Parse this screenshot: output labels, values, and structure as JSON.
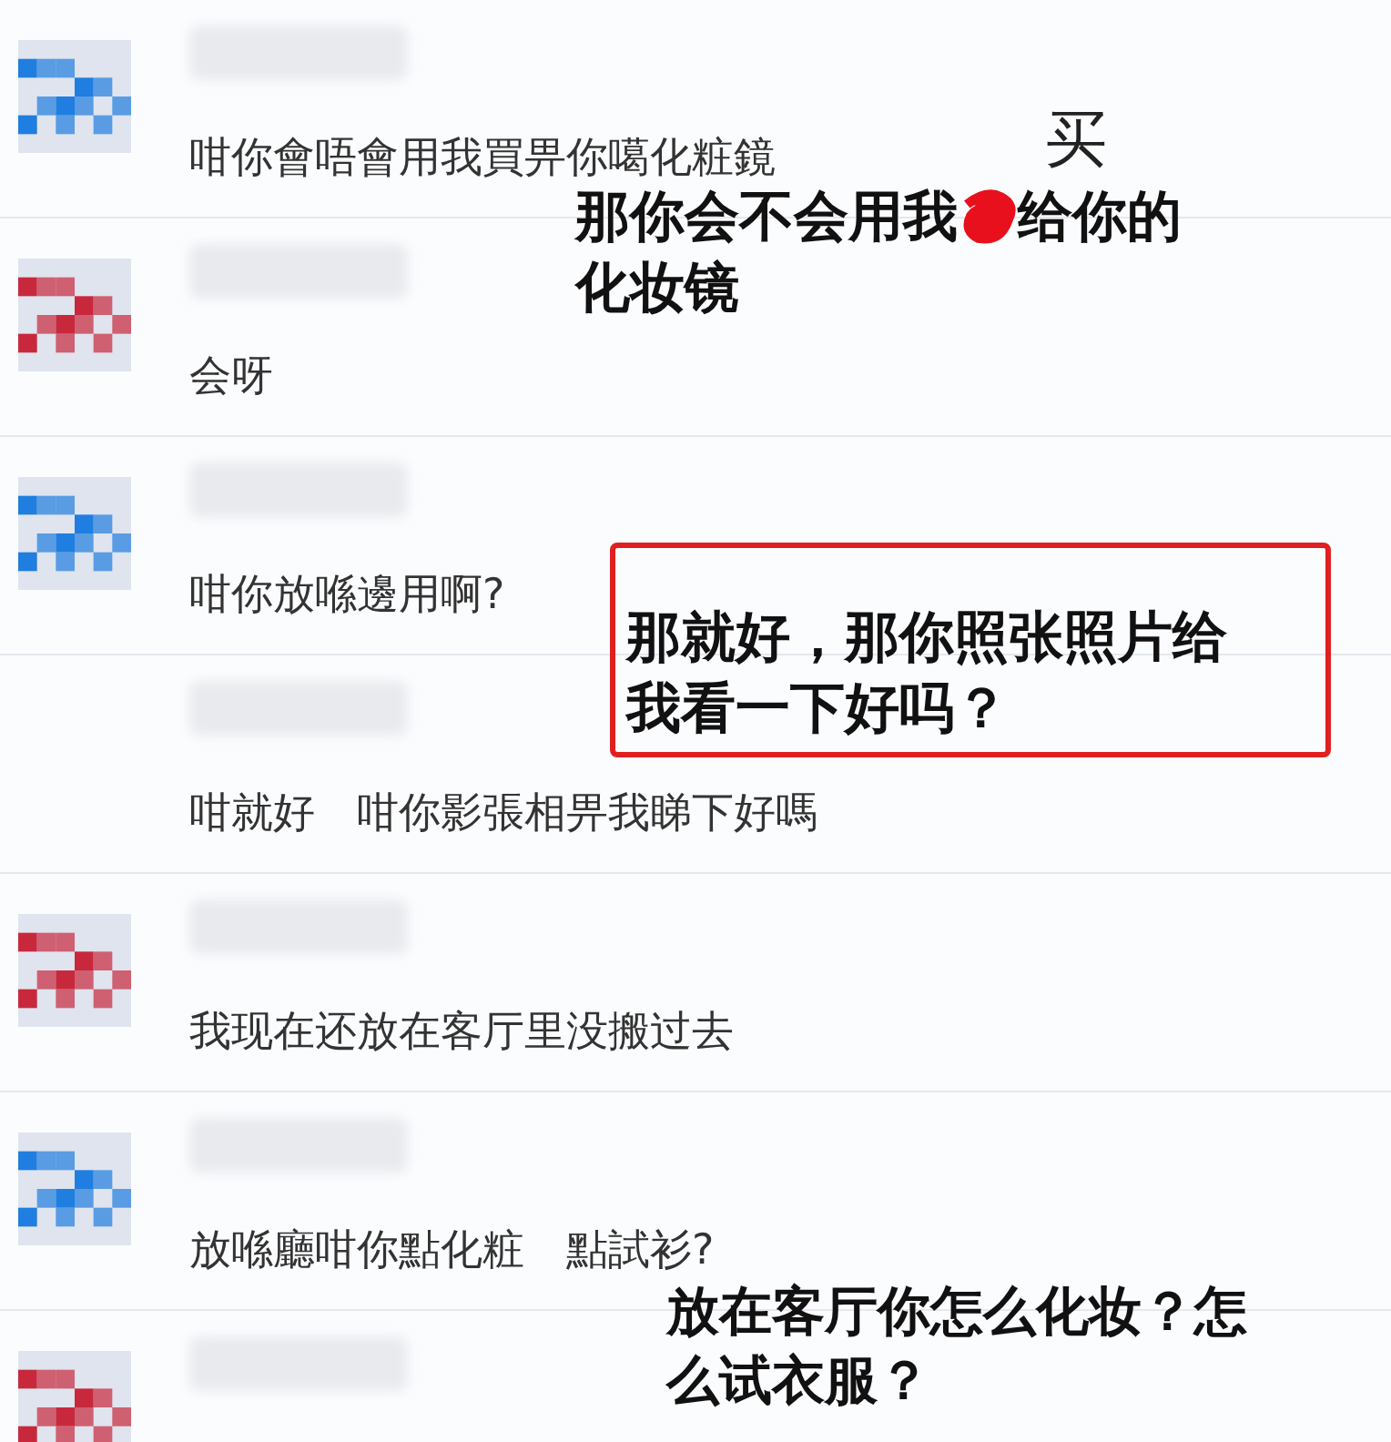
{
  "messages": [
    {
      "avatar": {
        "kind": "picture",
        "color": "#1f7ee0"
      },
      "text": "咁你會唔會用我買畀你噶化粧鏡"
    },
    {
      "avatar": {
        "kind": "picture",
        "color": "#c8283c"
      },
      "text": "会呀"
    },
    {
      "avatar": {
        "kind": "picture",
        "color": "#1f7ee0"
      },
      "text": "咁你放喺邊用啊?"
    },
    {
      "text": "咁就好　咁你影張相畀我睇下好嗎"
    },
    {
      "avatar": {
        "kind": "picture",
        "color": "#c8283c"
      },
      "text": "我现在还放在客厅里没搬过去"
    },
    {
      "avatar": {
        "kind": "picture",
        "color": "#1f7ee0"
      },
      "text": "放喺廳咁你點化粧　點試衫?"
    },
    {
      "avatar": {
        "kind": "picture",
        "color": "#c8283c"
      }
    }
  ],
  "annotations": [
    {
      "kind": "correction",
      "text_before": "那你会不会用我",
      "text_after": "给你的",
      "text_next_line": "化妆镜",
      "correction": "买"
    },
    {
      "kind": "boxed",
      "text": "那就好，那你照张照片给我看一下好吗？"
    },
    {
      "kind": "plain",
      "text": "放在客厅你怎么化妆？怎么试衣服？"
    }
  ]
}
